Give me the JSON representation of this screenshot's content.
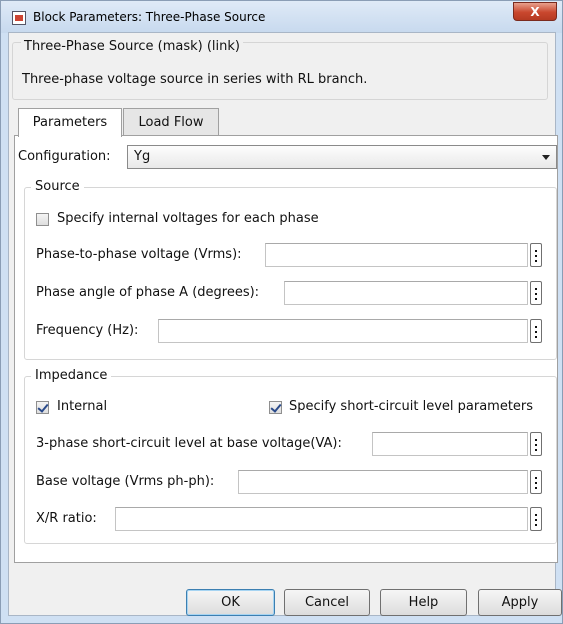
{
  "window": {
    "title": "Block Parameters: Three-Phase Source",
    "close_glyph": "X"
  },
  "mask": {
    "header": "Three-Phase Source (mask) (link)",
    "description": "Three-phase voltage source in series with RL branch."
  },
  "tabs": [
    {
      "label": "Parameters",
      "active": true
    },
    {
      "label": "Load Flow",
      "active": false
    }
  ],
  "configuration": {
    "label": "Configuration:",
    "value": "Yg"
  },
  "source": {
    "legend": "Source",
    "specify_internal": {
      "label": "Specify internal voltages for each phase",
      "checked": false
    },
    "phase_voltage": {
      "label": "Phase-to-phase voltage (Vrms):",
      "value": ""
    },
    "phase_angle": {
      "label": "Phase angle of phase A (degrees):",
      "value": ""
    },
    "frequency": {
      "label": "Frequency (Hz):",
      "value": ""
    }
  },
  "impedance": {
    "legend": "Impedance",
    "internal": {
      "label": "Internal",
      "checked": true
    },
    "specify_short_circuit": {
      "label": "Specify short-circuit level parameters",
      "checked": true
    },
    "short_circuit_level": {
      "label": "3-phase short-circuit level at base voltage(VA):",
      "value": ""
    },
    "base_voltage": {
      "label": "Base voltage (Vrms ph-ph):",
      "value": ""
    },
    "xr_ratio": {
      "label": "X/R ratio:",
      "value": ""
    }
  },
  "buttons": {
    "ok": "OK",
    "cancel": "Cancel",
    "help": "Help",
    "apply": "Apply"
  }
}
